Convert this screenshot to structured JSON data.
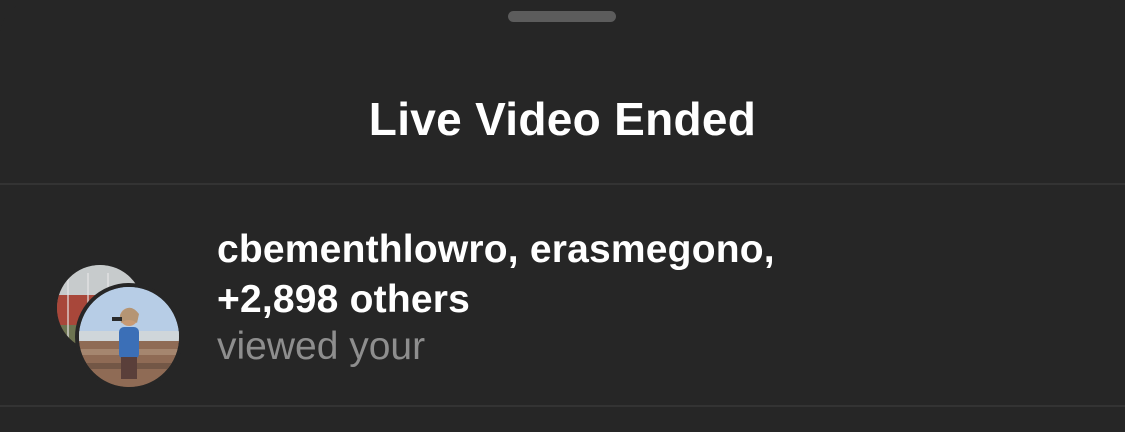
{
  "sheet": {
    "title": "Live Video Ended"
  },
  "viewers": {
    "names_line": "cbementhlowro, erasmegono,",
    "others_line": "+2,898 others",
    "subtitle": "viewed your"
  },
  "colors": {
    "background": "#262626",
    "divider": "#333333",
    "primary_text": "#ffffff",
    "secondary_text": "#8e8e8e"
  }
}
